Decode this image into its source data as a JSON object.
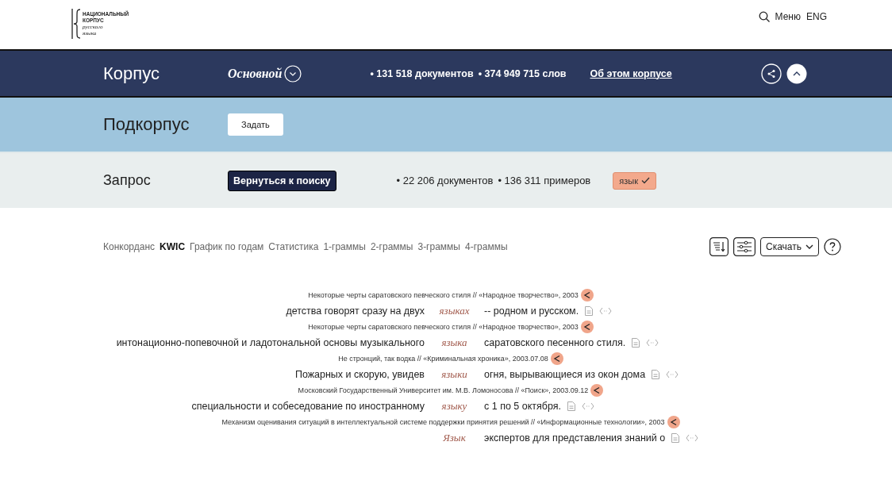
{
  "logo": {
    "lines": [
      "НАЦИОНАЛЬНЫЙ",
      "КОРПУС",
      "русского",
      "языка"
    ]
  },
  "top_nav": {
    "menu": "Меню",
    "language": "ENG"
  },
  "corpus_bar": {
    "label": "Корпус",
    "corpus": "Основной",
    "stats": [
      "• 131 518 документов",
      "• 374 949 715 слов"
    ],
    "about_link": "Об этом корпусе"
  },
  "subcorpus_bar": {
    "label": "Подкорпус",
    "button": "Задать"
  },
  "query_bar": {
    "label": "Запрос",
    "button": "Вернуться к поиску",
    "stats": [
      "• 22 206 документов",
      "• 136 311 примеров"
    ],
    "chip": {
      "text": "язык",
      "checked": true
    }
  },
  "tabs": [
    {
      "label": "Конкорданс",
      "selected": false
    },
    {
      "label": "KWIC",
      "selected": true
    },
    {
      "label": "График по годам",
      "selected": false
    },
    {
      "label": "Статистика",
      "selected": false
    },
    {
      "label": "1-граммы",
      "selected": false
    },
    {
      "label": "2-граммы",
      "selected": false
    },
    {
      "label": "3-граммы",
      "selected": false
    },
    {
      "label": "4-граммы",
      "selected": false
    }
  ],
  "download_button": "Скачать",
  "results": [
    {
      "source": "Некоторые черты саратовского певческого стиля // «Народное творчество», 2003",
      "left": "детства говорят сразу на двух",
      "keyword": "языках",
      "right": "-- родном и русском."
    },
    {
      "source": "Некоторые черты саратовского певческого стиля // «Народное творчество», 2003",
      "left": "интонационно-попевочной и ладотональной основы музыкального",
      "keyword": "языка",
      "right": "саратовского песенного стиля."
    },
    {
      "source": "Не стронций, так водка // «Криминальная хроника», 2003.07.08",
      "left": "Пожарных и скорую, увидев",
      "keyword": "языки",
      "right": "огня, вырывающиеся из окон дома"
    },
    {
      "source": "Московский Государственный Университет им. М.В. Ломоносова // «Поиск», 2003.09.12",
      "left": "специальности и собеседование по иностранному",
      "keyword": "языку",
      "right": "с 1 по 5 октября."
    },
    {
      "source": "Механизм оценивания ситуаций в интеллектуальной системе поддержки принятия решений // «Информационные технологии», 2003",
      "keyword": "Язык",
      "right": "экспертов для представления знаний о"
    }
  ]
}
